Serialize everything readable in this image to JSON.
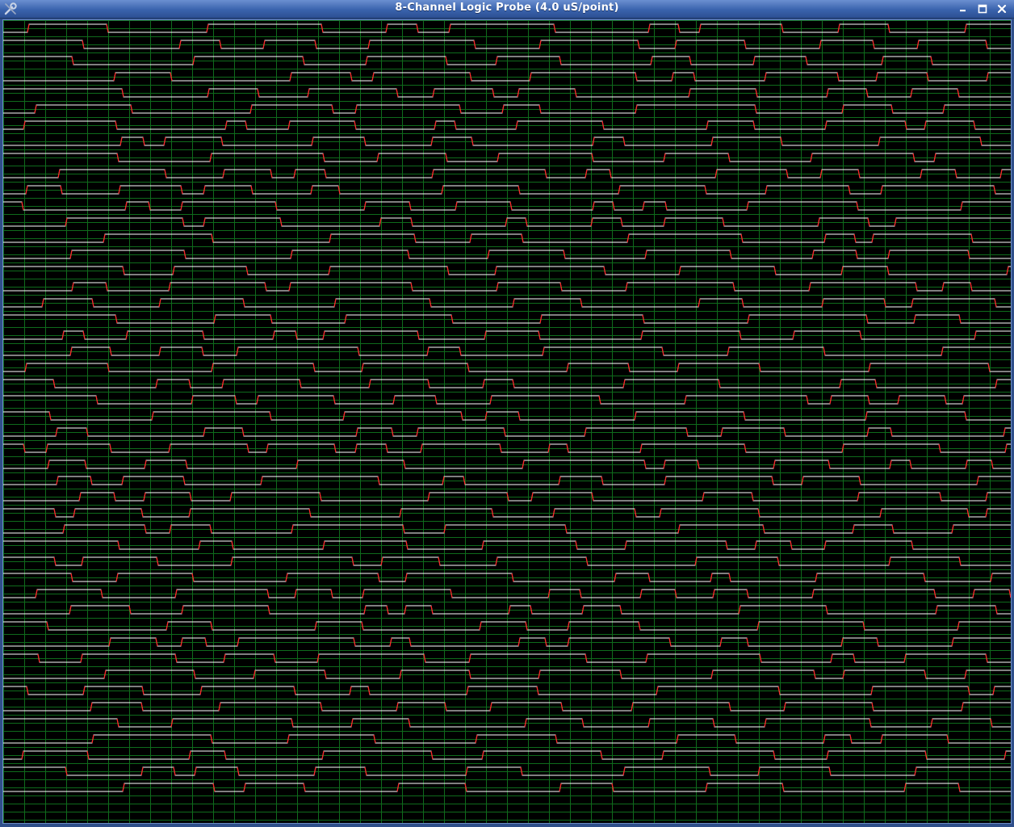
{
  "window": {
    "title": "8-Channel Logic Probe (4.0 uS/point)",
    "app_icon": "wrench-icon",
    "controls": [
      "minimize-icon",
      "maximize-icon",
      "close-icon"
    ]
  },
  "colors": {
    "background": "#000000",
    "grid": "#0f6b1c",
    "trace_level": "#ffffff",
    "trace_edge": "#ff2020",
    "titlebar": "#3a63ad"
  },
  "probe": {
    "channels_per_group": 8,
    "groups": 8,
    "grid_rows_per_group": 6,
    "grid_columns": 48,
    "time_per_point": "4.0 uS/point"
  }
}
